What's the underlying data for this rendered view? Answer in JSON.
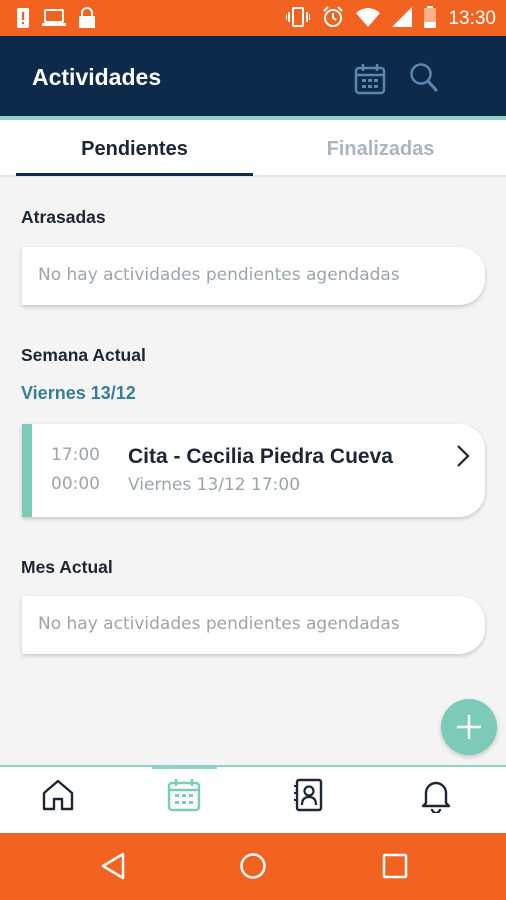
{
  "status_bar": {
    "time": "13:30",
    "icons": [
      "alert-icon",
      "laptop-icon",
      "lock-icon",
      "vibrate-icon",
      "alarm-icon",
      "wifi-icon",
      "signal-icon",
      "battery-icon"
    ]
  },
  "header": {
    "title": "Actividades",
    "icons": [
      "calendar-icon",
      "search-icon"
    ]
  },
  "tabs": [
    {
      "label": "Pendientes",
      "active": true
    },
    {
      "label": "Finalizadas",
      "active": false
    }
  ],
  "sections": {
    "overdue": {
      "title": "Atrasadas",
      "empty_text": "No hay actividades pendientes agendadas"
    },
    "current_week": {
      "title": "Semana Actual",
      "day_label": "Viernes 13/12",
      "activity": {
        "start_time": "17:00",
        "end_time": "00:00",
        "title": "Cita - Cecilia Piedra Cueva",
        "subtitle": "Viernes 13/12 17:00"
      }
    },
    "current_month": {
      "title": "Mes Actual",
      "empty_text": "No hay actividades pendientes agendadas"
    }
  },
  "fab": {
    "icon": "plus-icon"
  },
  "bottom_nav": {
    "items": [
      "home-icon",
      "calendar-icon",
      "contacts-icon",
      "bell-icon"
    ],
    "active": "calendar-icon"
  },
  "system_nav": [
    "back-icon",
    "home-circle-icon",
    "recent-apps-icon"
  ],
  "colors": {
    "status_bar": "#f26322",
    "header": "#0d2a4a",
    "accent": "#7ccbb8",
    "day_label": "#3a7e96"
  }
}
